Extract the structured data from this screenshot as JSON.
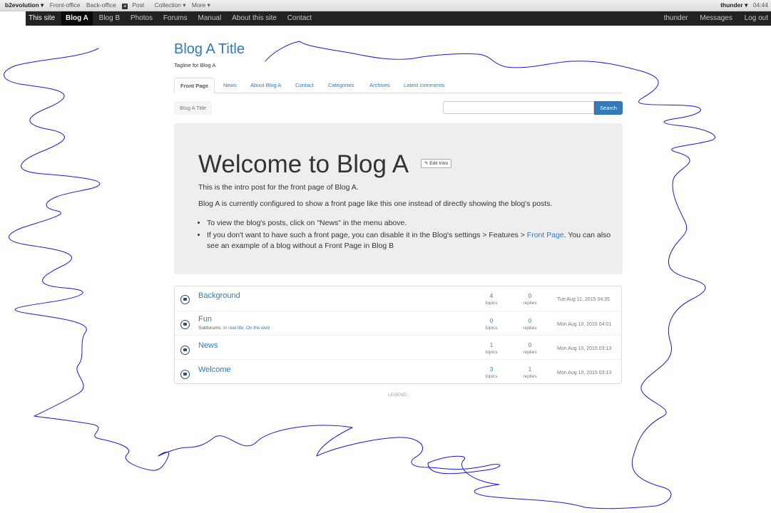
{
  "adminbar": {
    "brand": "b2evolution ▾",
    "items": [
      "Front-office",
      "Back-office",
      "Post",
      "Collection ▾",
      "More ▾"
    ],
    "user": "thunder ▾",
    "time": "04:44"
  },
  "sitebar": {
    "items": [
      "This site",
      "Blog A",
      "Blog B",
      "Photos",
      "Forums",
      "Manual",
      "About this site",
      "Contact"
    ],
    "active_index": 1,
    "right": [
      "thunder",
      "Messages",
      "Log out"
    ]
  },
  "blog": {
    "title": "Blog A Title",
    "tagline": "Tagline for Blog A"
  },
  "tabs": [
    "Front Page",
    "News",
    "About Blog A",
    "Contact",
    "Categories",
    "Archives",
    "Latest comments"
  ],
  "breadcrumb": "Blog A Title",
  "search": {
    "button": "Search",
    "value": ""
  },
  "intro": {
    "heading": "Welcome to Blog A",
    "edit_label": "Edit Intro",
    "p1": "This is the intro post for the front page of Blog A.",
    "p2": "Blog A is currently configured to show a front page like this one instead of directly showing the blog's posts.",
    "li1": "To view the blog's posts, click on \"News\" in the menu above.",
    "li2_a": "If you don't want to have such a front page, you can disable it in the Blog's settings > Features > ",
    "li2_link": "Front Page",
    "li2_b": ". You can also see an example of a blog without a Front Page in Blog B"
  },
  "forums": [
    {
      "name": "Background",
      "topics": "4",
      "replies": "0",
      "date": "Tue Aug 11, 2015 04:35",
      "subforums": []
    },
    {
      "name": "Fun",
      "topics": "0",
      "replies": "0",
      "date": "Mon Aug 10, 2015 04:01",
      "subforums_label": "Subforums:",
      "subforums": "In real life, On the web"
    },
    {
      "name": "News",
      "topics": "1",
      "replies": "0",
      "date": "Mon Aug 10, 2015 03:13",
      "subforums": []
    },
    {
      "name": "Welcome",
      "topics": "3",
      "replies": "1",
      "date": "Mon Aug 10, 2015 03:13",
      "subforums": []
    }
  ],
  "labels": {
    "topics": "topics",
    "replies": "replies"
  },
  "legend": "LEGEND:",
  "colors": {
    "link": "#337ab7",
    "navbar": "#222222",
    "scribble": "#1a1acc"
  }
}
